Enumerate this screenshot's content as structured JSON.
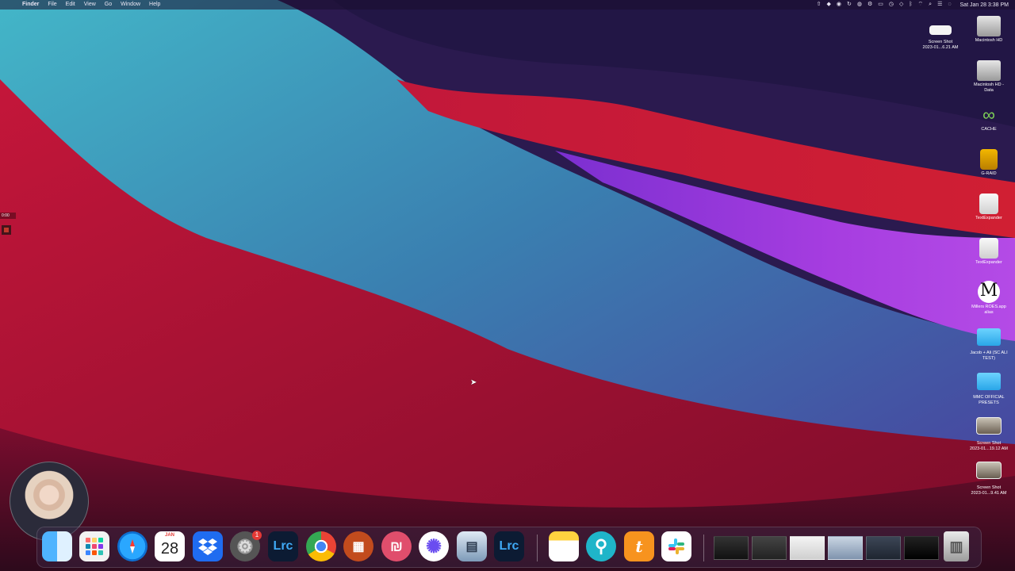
{
  "menubar": {
    "app_name": "Finder",
    "menus": [
      "File",
      "Edit",
      "View",
      "Go",
      "Window",
      "Help"
    ],
    "clock": "Sat Jan 28  3:38 PM"
  },
  "recorder": {
    "time": "0:00"
  },
  "desktop_items": [
    {
      "label": "Screen Shot\n2023-01...6.21 AM",
      "icon": "screenshot-icon"
    },
    {
      "label": "Macintosh HD",
      "icon": "drive-icon"
    },
    {
      "label": "Macintosh HD -\nData",
      "icon": "drive-icon"
    },
    {
      "label": "CACHE",
      "icon": "cache-icon"
    },
    {
      "label": "G-RAID",
      "icon": "drive-icon"
    },
    {
      "label": "TextExpander",
      "icon": "disk-image-icon"
    },
    {
      "label": "TextExpander",
      "icon": "disk-image-icon"
    },
    {
      "label": "Millers ROES.app\nalias",
      "icon": "app-alias-icon"
    },
    {
      "label": "Jacob + Ali (SC ALI\nTEST)",
      "icon": "folder-icon"
    },
    {
      "label": "MMC OFFICIAL\nPRESETS",
      "icon": "folder-icon"
    },
    {
      "label": "Screen Shot\n2023-01...19.12 AM",
      "icon": "screenshot-icon"
    },
    {
      "label": "Screen Shot\n2023-01...9.41 AM",
      "icon": "screenshot-icon"
    }
  ],
  "dock": {
    "calendar_month": "JAN",
    "calendar_day": "28",
    "settings_badge": "1",
    "lrc_label": "Lrc",
    "lrc2_label": "Lrc"
  }
}
